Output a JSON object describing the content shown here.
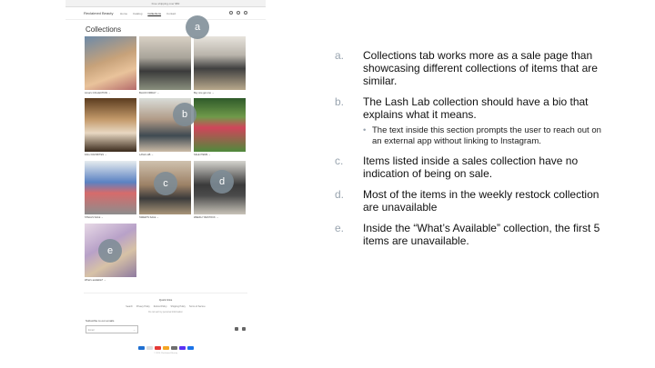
{
  "site": {
    "announcement": "Free shipping over $50",
    "brand": "Reclaimed Beauty",
    "nav": [
      "Home",
      "Catalog",
      "Collections",
      "Contact"
    ],
    "page_title": "Collections",
    "collections": [
      {
        "caption": "Anna's COLLECTION →"
      },
      {
        "caption": "BLACK FRIDAY →"
      },
      {
        "caption": "Buy one get one →"
      },
      {
        "caption": "FALL FAVORITES →"
      },
      {
        "caption": "LASH LAB →"
      },
      {
        "caption": "SALE ITEMS →"
      },
      {
        "caption": "STEALS SALE →"
      },
      {
        "caption": "SWEETS SALE →"
      },
      {
        "caption": "WEEKLY RESTOCK →"
      },
      {
        "caption": "What's available? →"
      }
    ],
    "footer": {
      "quick_links": "Quick links",
      "links": [
        "Search",
        "Privacy Policy",
        "Refund Policy",
        "Shipping Policy",
        "Terms of Service"
      ],
      "note": "Do not sell my personal information",
      "subscribe": "Subscribe to our emails",
      "email_placeholder": "Email",
      "copyright": "© 2024, Reclaimed Beauty"
    },
    "payment_colors": [
      "#1f6fd1",
      "#dddddd",
      "#e53935",
      "#f5a623",
      "#6e6e6e",
      "#5a31f4",
      "#1a73e8"
    ]
  },
  "markers": [
    "a",
    "b",
    "c",
    "d",
    "e"
  ],
  "notes": [
    {
      "letter": "a.",
      "text": "Collections tab works more as a sale page than showcasing different collections of items that are similar."
    },
    {
      "letter": "b.",
      "text": "The Lash Lab collection should have a bio that explains what it means.",
      "sub": "The text inside this section prompts the user to reach out on an external app without linking to Instagram."
    },
    {
      "letter": "c.",
      "text": "Items listed inside a sales collection have no indication of being on sale."
    },
    {
      "letter": "d.",
      "text": "Most of the items in the weekly restock collection are unavailable"
    },
    {
      "letter": "e.",
      "text": "Inside the “What’s Available” collection, the first 5 items are unavailable."
    }
  ]
}
